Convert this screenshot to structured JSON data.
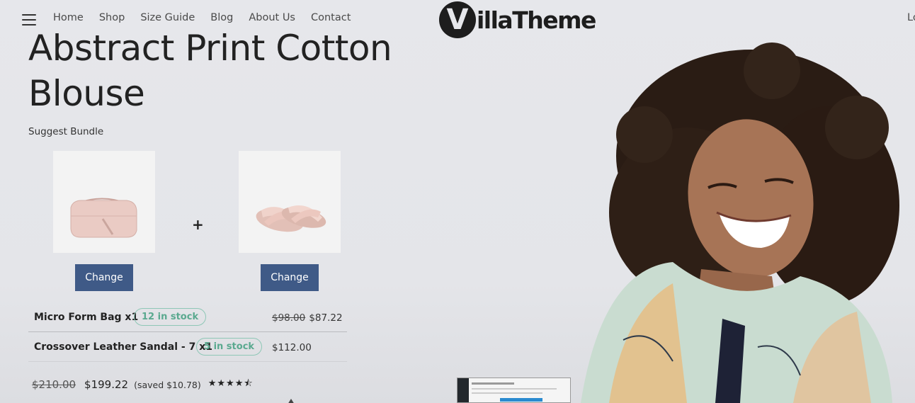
{
  "nav": {
    "items": [
      "Home",
      "Shop",
      "Size Guide",
      "Blog",
      "About Us",
      "Contact"
    ],
    "login_fragment": "Lo"
  },
  "logo": {
    "letter": "V",
    "text": "illaTheme"
  },
  "product": {
    "title": "Abstract Print Cotton Blouse"
  },
  "bundle": {
    "label": "Suggest Bundle",
    "plus": "+",
    "change_label": "Change",
    "items": [
      {
        "name": "Micro Form Bag x1",
        "stock": "12 in stock",
        "old_price": "$98.00",
        "price": "$87.22"
      },
      {
        "name": "Crossover Leather Sandal - 7 x1",
        "stock": "5 in stock",
        "old_price": "",
        "price": "$112.00"
      }
    ],
    "total_old": "$210.00",
    "total_new": "$199.22",
    "saved": "(saved $10.78)",
    "rating": 4.5,
    "stars_text": "★★★★⯪"
  },
  "colors": {
    "button": "#3f5a87",
    "stock_badge": "#5aa98f",
    "background": "#e5e6ea"
  },
  "icons": [
    "menu-icon",
    "bag-image",
    "sandal-image",
    "star-rating-icons"
  ]
}
